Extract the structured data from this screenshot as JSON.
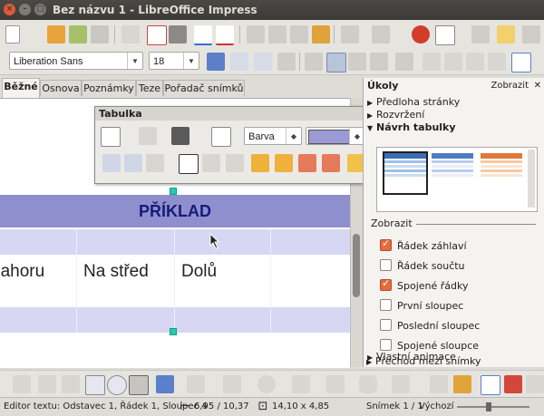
{
  "window": {
    "title": "Bez názvu 1 - LibreOffice Impress"
  },
  "format_toolbar": {
    "font_name": "Liberation Sans",
    "font_size": "18"
  },
  "view_tabs": [
    "Běžné",
    "Osnova",
    "Poznámky",
    "Teze",
    "Pořadač snímků"
  ],
  "table_toolbar": {
    "title": "Tabulka",
    "fill_style": "Barva",
    "fill_color": "#9a9ad6"
  },
  "slide": {
    "header_text": "PŘÍKLAD",
    "cells": [
      "nahoru",
      "Na střed",
      "Dolů"
    ],
    "header_color": "#8f8fce",
    "band_color": "#d7d7f3"
  },
  "task_panel": {
    "title": "Úkoly",
    "view_label": "Zobrazit",
    "sections": [
      "Předloha stránky",
      "Rozvržení",
      "Návrh tabulky"
    ],
    "show_label": "Zobrazit",
    "options": [
      {
        "label": "Řádek záhlaví",
        "checked": true
      },
      {
        "label": "Řádek součtu",
        "checked": false
      },
      {
        "label": "Spojené řádky",
        "checked": true
      },
      {
        "label": "První sloupec",
        "checked": false
      },
      {
        "label": "Poslední sloupec",
        "checked": false
      },
      {
        "label": "Spojené sloupce",
        "checked": false
      }
    ],
    "bottom_sections": [
      "Vlastní animace",
      "Přechod mezi snímky"
    ]
  },
  "status": {
    "mode": "Editor textu: Odstavec 1, Řádek 1, Sloupec 4",
    "position": "6,95 / 10,37",
    "size": "14,10 x 4,85",
    "slide": "Snímek 1 / 1",
    "layout": "Výchozí"
  }
}
